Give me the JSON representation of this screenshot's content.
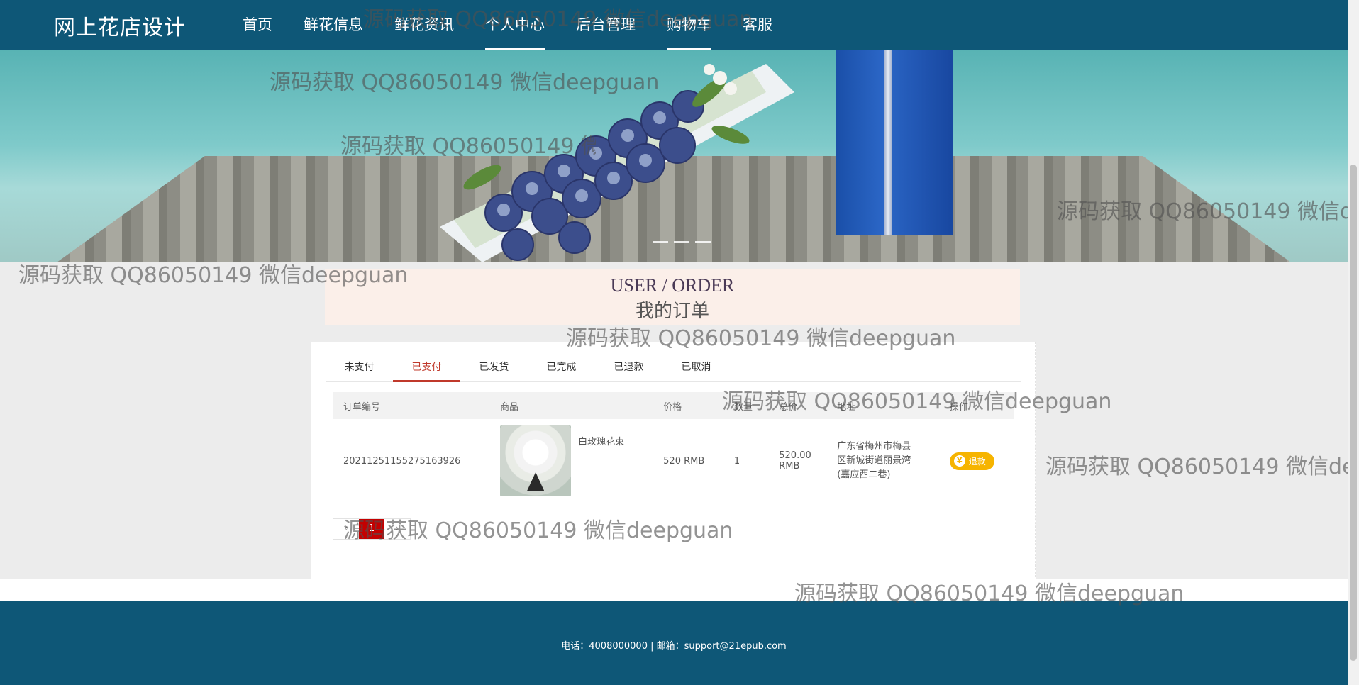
{
  "header": {
    "brand": "网上花店设计",
    "nav": [
      "首页",
      "鲜花信息",
      "鲜花资讯",
      "个人中心",
      "后台管理",
      "购物车",
      "客服"
    ]
  },
  "section": {
    "title_en": "USER / ORDER",
    "title_cn": "我的订单"
  },
  "orders": {
    "tabs": [
      "未支付",
      "已支付",
      "已发货",
      "已完成",
      "已退款",
      "已取消"
    ],
    "active_tab": "已支付",
    "columns": [
      "订单编号",
      "商品",
      "价格",
      "数量",
      "总价",
      "地址",
      "操作"
    ],
    "rows": [
      {
        "order_no": "20211251155275163926",
        "goods_name": "白玫瑰花束",
        "price": "520 RMB",
        "quantity": "1",
        "total": "520.00 RMB",
        "address": "广东省梅州市梅县区新城街道丽景湾(嘉应西二巷)",
        "action": "退款"
      }
    ],
    "pager": {
      "current": "1"
    }
  },
  "footer": {
    "info": "电话：4008000000 | 邮箱：support@21epub.com"
  },
  "watermark": "源码获取 QQ86050149 微信deepguan",
  "colors": {
    "header_bg": "#0e5777",
    "accent": "#c0392b",
    "refund": "#f6b400"
  }
}
